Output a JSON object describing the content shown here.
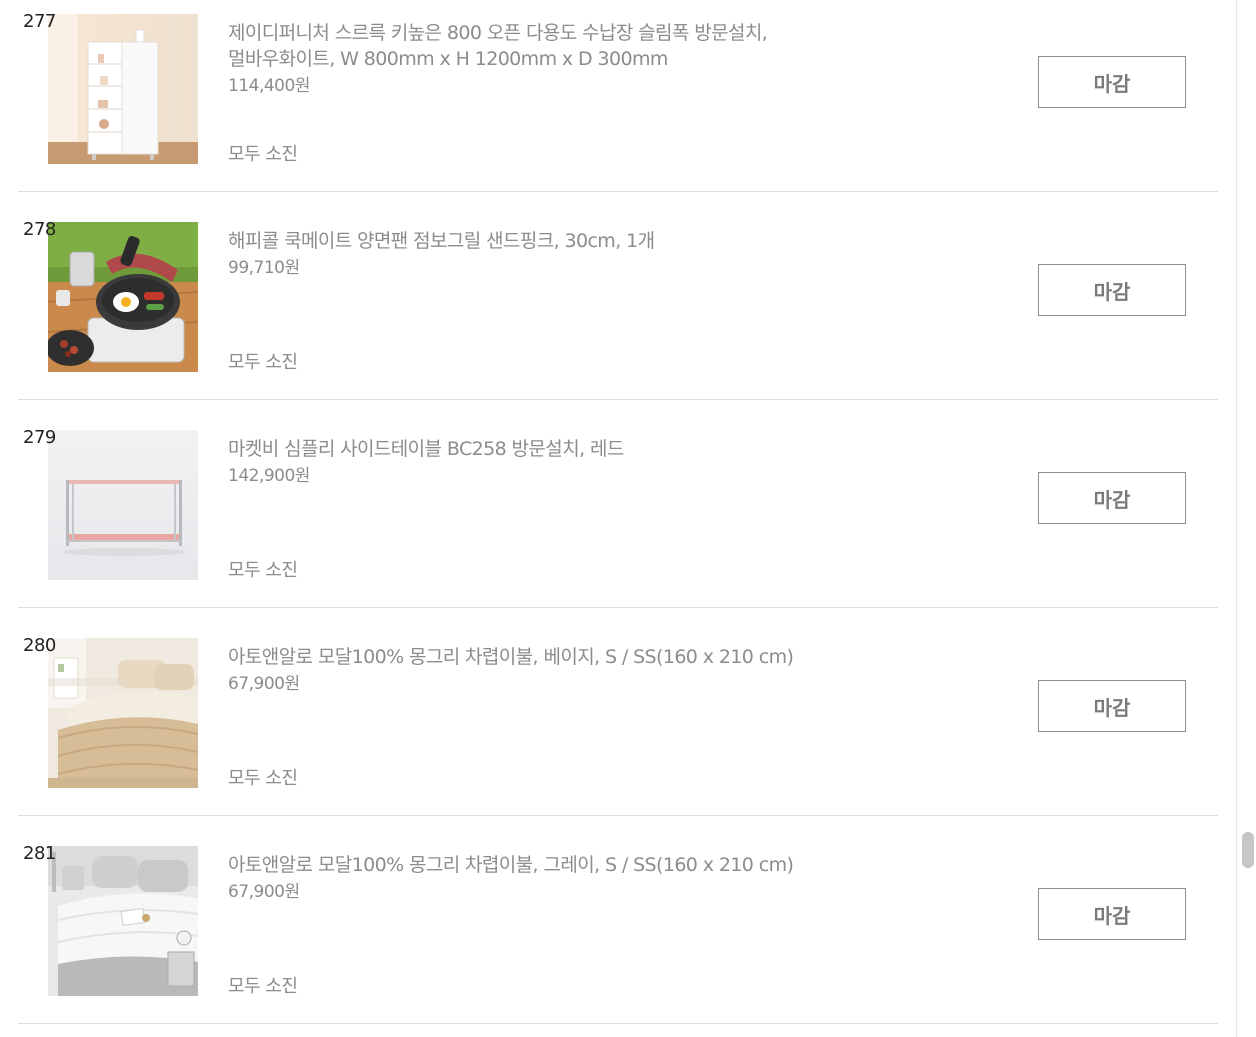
{
  "items": [
    {
      "rank": "277",
      "title_line1": "제이디퍼니처 스르륵 키높은 800 오픈 다용도 수납장 슬림폭 방문설치,",
      "title_line2": "멀바우화이트, W 800mm x H 1200mm x D 300mm",
      "price": "114,400원",
      "status": "모두 소진",
      "button": "마감",
      "image_icon": "white-cabinet-image"
    },
    {
      "rank": "278",
      "title_line1": "해피콜 쿡메이트 양면팬 점보그릴 샌드핑크, 30cm, 1개",
      "title_line2": "",
      "price": "99,710원",
      "status": "모두 소진",
      "button": "마감",
      "image_icon": "grill-pan-image"
    },
    {
      "rank": "279",
      "title_line1": "마켓비 심플리 사이드테이블 BC258 방문설치, 레드",
      "title_line2": "",
      "price": "142,900원",
      "status": "모두 소진",
      "button": "마감",
      "image_icon": "side-table-image"
    },
    {
      "rank": "280",
      "title_line1": "아토앤알로 모달100% 몽그리 차렵이불, 베이지, S / SS(160 x 210 cm)",
      "title_line2": "",
      "price": "67,900원",
      "status": "모두 소진",
      "button": "마감",
      "image_icon": "beige-bedding-image"
    },
    {
      "rank": "281",
      "title_line1": "아토앤알로 모달100% 몽그리 차렵이불, 그레이, S / SS(160 x 210 cm)",
      "title_line2": "",
      "price": "67,900원",
      "status": "모두 소진",
      "button": "마감",
      "image_icon": "gray-bedding-image"
    }
  ],
  "colors": {
    "text_muted": "#8c8c8c",
    "divider": "#dedede",
    "button_border": "#8c8c8c"
  }
}
